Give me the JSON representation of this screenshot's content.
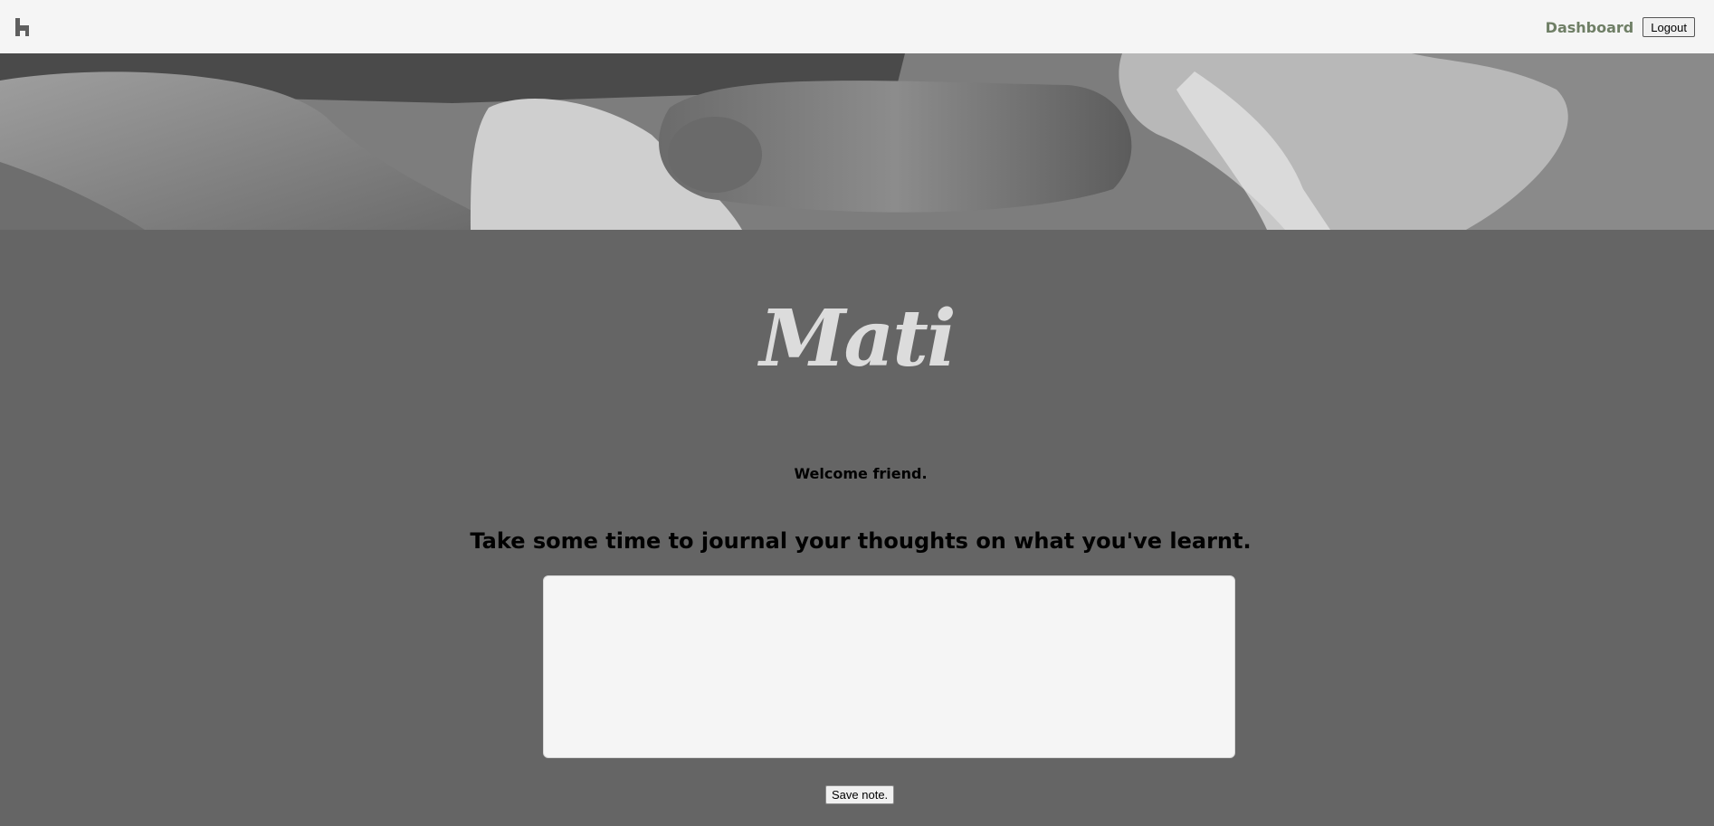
{
  "topbar": {
    "home_icon": "home-icon",
    "dashboard_label": "Dashboard",
    "logout_label": "Logout"
  },
  "hero": {
    "image": "black-and-white photo of baby hands"
  },
  "logo": {
    "text": "Mati"
  },
  "welcome": {
    "text": "Welcome friend."
  },
  "journal": {
    "prompt": "Take some time to journal your thoughts on what you've learnt.",
    "note_value": "",
    "save_label": "Save note."
  },
  "colors": {
    "page_bg": "#656565",
    "topbar_bg": "#f5f5f5",
    "link": "#6f7f66",
    "logo": "#dcdcdc"
  }
}
